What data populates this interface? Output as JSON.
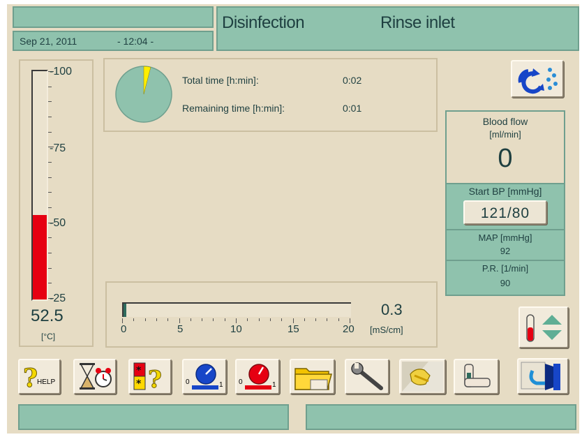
{
  "header": {
    "date": "Sep 21, 2011",
    "time": "- 12:04 -",
    "mode": "Disinfection",
    "step": "Rinse inlet"
  },
  "temperature": {
    "scale_labels": [
      "-100",
      "-75",
      "-50",
      "-25"
    ],
    "value": "52.5",
    "unit": "[°C]",
    "fill_fraction": 0.37,
    "fill_color": "#e60012"
  },
  "times": {
    "total_label": "Total time [h:min]:",
    "total_value": "0:02",
    "remaining_label": "Remaining time [h:min]:",
    "remaining_value": "0:01",
    "progress_fraction": 0.04
  },
  "conductivity": {
    "tick_labels": [
      "0",
      "5",
      "10",
      "15",
      "20"
    ],
    "value": "0.3",
    "unit": "[mS/cm]"
  },
  "blood_flow": {
    "title": "Blood flow",
    "unit": "[ml/min]",
    "value": "0"
  },
  "bp": {
    "start_label": "Start BP [mmHg]",
    "start_value": "121/80",
    "map_label": "MAP  [mmHg]",
    "map_value": "92",
    "pr_label": "P.R. [1/min]",
    "pr_value": "90"
  },
  "toolbar": {
    "help_text": "HELP",
    "scale_zero": "0",
    "scale_one": "1"
  },
  "icons": [
    "disinfection-cycle-icon",
    "help-icon",
    "timer-icon",
    "alarm-help-icon",
    "blue-gauge-icon",
    "red-gauge-icon",
    "folder-icon",
    "wrench-icon",
    "cleaning-icon",
    "arm-icon",
    "exit-icon",
    "temperature-adjust-icon"
  ],
  "colors": {
    "panel_green": "#8fc2ad",
    "background": "#e6dcc4",
    "alarm_red": "#e60012",
    "accent_yellow": "#ffef00"
  }
}
